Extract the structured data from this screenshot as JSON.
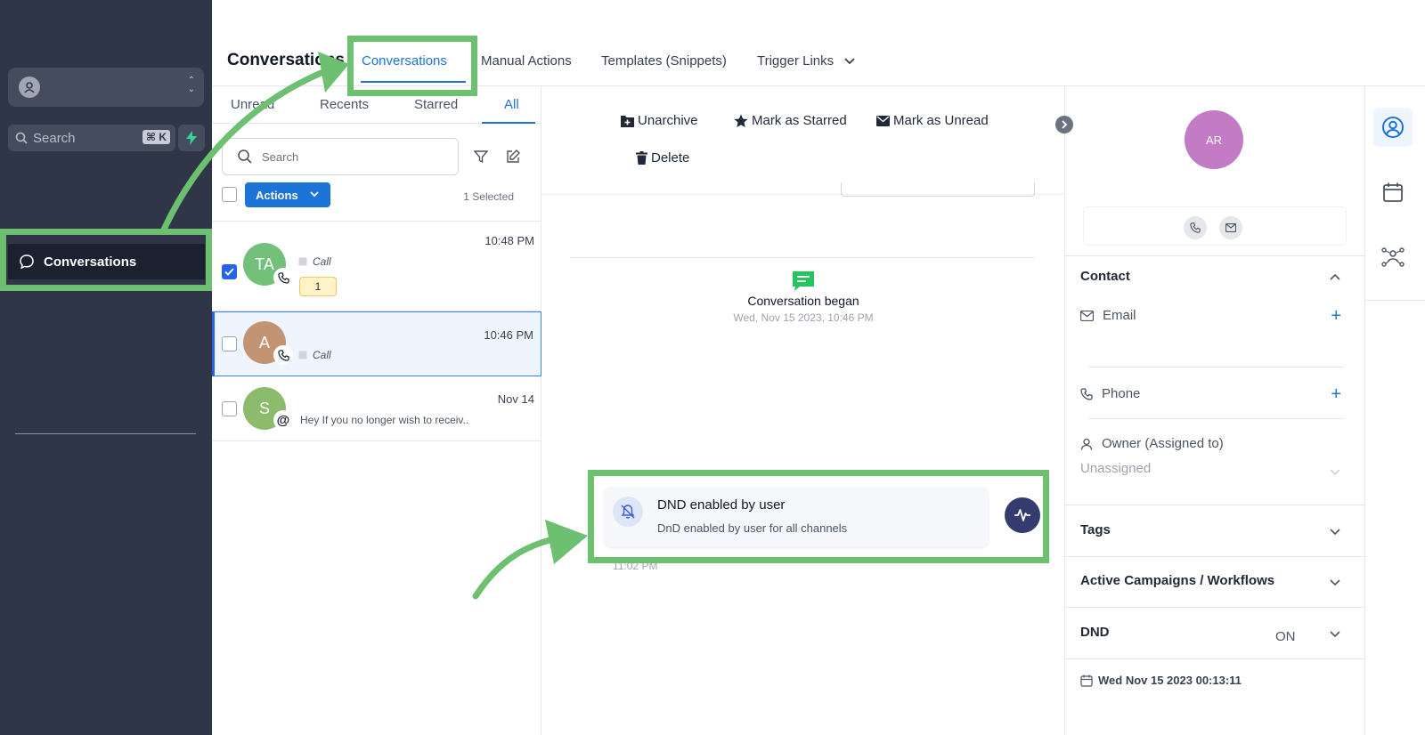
{
  "sidebar": {
    "search_placeholder": "Search",
    "search_shortcut": "⌘ K",
    "nav_item_label": "Conversations"
  },
  "header": {
    "title": "Conversations",
    "tabs": [
      "Conversations",
      "Manual Actions",
      "Templates (Snippets)",
      "Trigger Links"
    ],
    "active_tab": "Conversations"
  },
  "list": {
    "filters": [
      "Unread",
      "Recents",
      "Starred",
      "All"
    ],
    "active_filter": "All",
    "search_placeholder": "Search",
    "actions_label": "Actions",
    "selected_text": "1 Selected",
    "items": [
      {
        "initials": "TA",
        "avatar_color": "#73c07a",
        "channel": "Call",
        "time": "10:48 PM",
        "unread": "1",
        "checked": true,
        "selected": false
      },
      {
        "initials": "A",
        "avatar_color": "#c39474",
        "channel": "Call",
        "time": "10:46 PM",
        "checked": false,
        "selected": true
      },
      {
        "initials": "S",
        "avatar_color": "#8cbb6b",
        "snippet": "Hey If you no longer wish to receiv..",
        "time": "Nov 14",
        "checked": false,
        "selected": false
      }
    ]
  },
  "message_pane": {
    "actions": [
      "Unarchive",
      "Mark as Starred",
      "Mark as Unread",
      "Delete"
    ],
    "conversation_began_title": "Conversation began",
    "conversation_began_date": "Wed, Nov 15 2023, 10:46 PM",
    "dnd_title": "DND enabled by user",
    "dnd_subtitle": "DnD enabled by user for all channels",
    "dnd_time": "11:02 PM"
  },
  "contact": {
    "avatar_initials": "AR",
    "avatar_color": "#c27bc4",
    "section_contact": "Contact",
    "email_label": "Email",
    "phone_label": "Phone",
    "owner_label": "Owner (Assigned to)",
    "owner_value": "Unassigned",
    "section_tags": "Tags",
    "section_campaigns": "Active Campaigns / Workflows",
    "section_dnd": "DND",
    "dnd_status": "ON",
    "dnd_date": "Wed Nov 15 2023 00:13:11"
  },
  "colors": {
    "accent": "#1d74d8",
    "sidebar_bg": "#2f3647",
    "highlight": "#6cc070"
  }
}
